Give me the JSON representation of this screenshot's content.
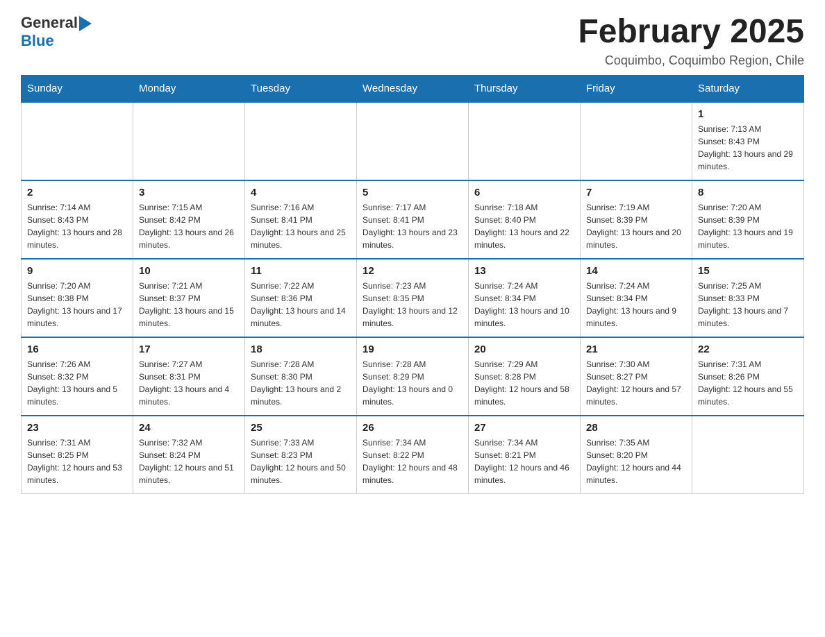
{
  "header": {
    "logo_general": "General",
    "logo_blue": "Blue",
    "month_title": "February 2025",
    "location": "Coquimbo, Coquimbo Region, Chile"
  },
  "weekdays": [
    "Sunday",
    "Monday",
    "Tuesday",
    "Wednesday",
    "Thursday",
    "Friday",
    "Saturday"
  ],
  "weeks": [
    [
      {
        "day": "",
        "sunrise": "",
        "sunset": "",
        "daylight": ""
      },
      {
        "day": "",
        "sunrise": "",
        "sunset": "",
        "daylight": ""
      },
      {
        "day": "",
        "sunrise": "",
        "sunset": "",
        "daylight": ""
      },
      {
        "day": "",
        "sunrise": "",
        "sunset": "",
        "daylight": ""
      },
      {
        "day": "",
        "sunrise": "",
        "sunset": "",
        "daylight": ""
      },
      {
        "day": "",
        "sunrise": "",
        "sunset": "",
        "daylight": ""
      },
      {
        "day": "1",
        "sunrise": "Sunrise: 7:13 AM",
        "sunset": "Sunset: 8:43 PM",
        "daylight": "Daylight: 13 hours and 29 minutes."
      }
    ],
    [
      {
        "day": "2",
        "sunrise": "Sunrise: 7:14 AM",
        "sunset": "Sunset: 8:43 PM",
        "daylight": "Daylight: 13 hours and 28 minutes."
      },
      {
        "day": "3",
        "sunrise": "Sunrise: 7:15 AM",
        "sunset": "Sunset: 8:42 PM",
        "daylight": "Daylight: 13 hours and 26 minutes."
      },
      {
        "day": "4",
        "sunrise": "Sunrise: 7:16 AM",
        "sunset": "Sunset: 8:41 PM",
        "daylight": "Daylight: 13 hours and 25 minutes."
      },
      {
        "day": "5",
        "sunrise": "Sunrise: 7:17 AM",
        "sunset": "Sunset: 8:41 PM",
        "daylight": "Daylight: 13 hours and 23 minutes."
      },
      {
        "day": "6",
        "sunrise": "Sunrise: 7:18 AM",
        "sunset": "Sunset: 8:40 PM",
        "daylight": "Daylight: 13 hours and 22 minutes."
      },
      {
        "day": "7",
        "sunrise": "Sunrise: 7:19 AM",
        "sunset": "Sunset: 8:39 PM",
        "daylight": "Daylight: 13 hours and 20 minutes."
      },
      {
        "day": "8",
        "sunrise": "Sunrise: 7:20 AM",
        "sunset": "Sunset: 8:39 PM",
        "daylight": "Daylight: 13 hours and 19 minutes."
      }
    ],
    [
      {
        "day": "9",
        "sunrise": "Sunrise: 7:20 AM",
        "sunset": "Sunset: 8:38 PM",
        "daylight": "Daylight: 13 hours and 17 minutes."
      },
      {
        "day": "10",
        "sunrise": "Sunrise: 7:21 AM",
        "sunset": "Sunset: 8:37 PM",
        "daylight": "Daylight: 13 hours and 15 minutes."
      },
      {
        "day": "11",
        "sunrise": "Sunrise: 7:22 AM",
        "sunset": "Sunset: 8:36 PM",
        "daylight": "Daylight: 13 hours and 14 minutes."
      },
      {
        "day": "12",
        "sunrise": "Sunrise: 7:23 AM",
        "sunset": "Sunset: 8:35 PM",
        "daylight": "Daylight: 13 hours and 12 minutes."
      },
      {
        "day": "13",
        "sunrise": "Sunrise: 7:24 AM",
        "sunset": "Sunset: 8:34 PM",
        "daylight": "Daylight: 13 hours and 10 minutes."
      },
      {
        "day": "14",
        "sunrise": "Sunrise: 7:24 AM",
        "sunset": "Sunset: 8:34 PM",
        "daylight": "Daylight: 13 hours and 9 minutes."
      },
      {
        "day": "15",
        "sunrise": "Sunrise: 7:25 AM",
        "sunset": "Sunset: 8:33 PM",
        "daylight": "Daylight: 13 hours and 7 minutes."
      }
    ],
    [
      {
        "day": "16",
        "sunrise": "Sunrise: 7:26 AM",
        "sunset": "Sunset: 8:32 PM",
        "daylight": "Daylight: 13 hours and 5 minutes."
      },
      {
        "day": "17",
        "sunrise": "Sunrise: 7:27 AM",
        "sunset": "Sunset: 8:31 PM",
        "daylight": "Daylight: 13 hours and 4 minutes."
      },
      {
        "day": "18",
        "sunrise": "Sunrise: 7:28 AM",
        "sunset": "Sunset: 8:30 PM",
        "daylight": "Daylight: 13 hours and 2 minutes."
      },
      {
        "day": "19",
        "sunrise": "Sunrise: 7:28 AM",
        "sunset": "Sunset: 8:29 PM",
        "daylight": "Daylight: 13 hours and 0 minutes."
      },
      {
        "day": "20",
        "sunrise": "Sunrise: 7:29 AM",
        "sunset": "Sunset: 8:28 PM",
        "daylight": "Daylight: 12 hours and 58 minutes."
      },
      {
        "day": "21",
        "sunrise": "Sunrise: 7:30 AM",
        "sunset": "Sunset: 8:27 PM",
        "daylight": "Daylight: 12 hours and 57 minutes."
      },
      {
        "day": "22",
        "sunrise": "Sunrise: 7:31 AM",
        "sunset": "Sunset: 8:26 PM",
        "daylight": "Daylight: 12 hours and 55 minutes."
      }
    ],
    [
      {
        "day": "23",
        "sunrise": "Sunrise: 7:31 AM",
        "sunset": "Sunset: 8:25 PM",
        "daylight": "Daylight: 12 hours and 53 minutes."
      },
      {
        "day": "24",
        "sunrise": "Sunrise: 7:32 AM",
        "sunset": "Sunset: 8:24 PM",
        "daylight": "Daylight: 12 hours and 51 minutes."
      },
      {
        "day": "25",
        "sunrise": "Sunrise: 7:33 AM",
        "sunset": "Sunset: 8:23 PM",
        "daylight": "Daylight: 12 hours and 50 minutes."
      },
      {
        "day": "26",
        "sunrise": "Sunrise: 7:34 AM",
        "sunset": "Sunset: 8:22 PM",
        "daylight": "Daylight: 12 hours and 48 minutes."
      },
      {
        "day": "27",
        "sunrise": "Sunrise: 7:34 AM",
        "sunset": "Sunset: 8:21 PM",
        "daylight": "Daylight: 12 hours and 46 minutes."
      },
      {
        "day": "28",
        "sunrise": "Sunrise: 7:35 AM",
        "sunset": "Sunset: 8:20 PM",
        "daylight": "Daylight: 12 hours and 44 minutes."
      },
      {
        "day": "",
        "sunrise": "",
        "sunset": "",
        "daylight": ""
      }
    ]
  ]
}
